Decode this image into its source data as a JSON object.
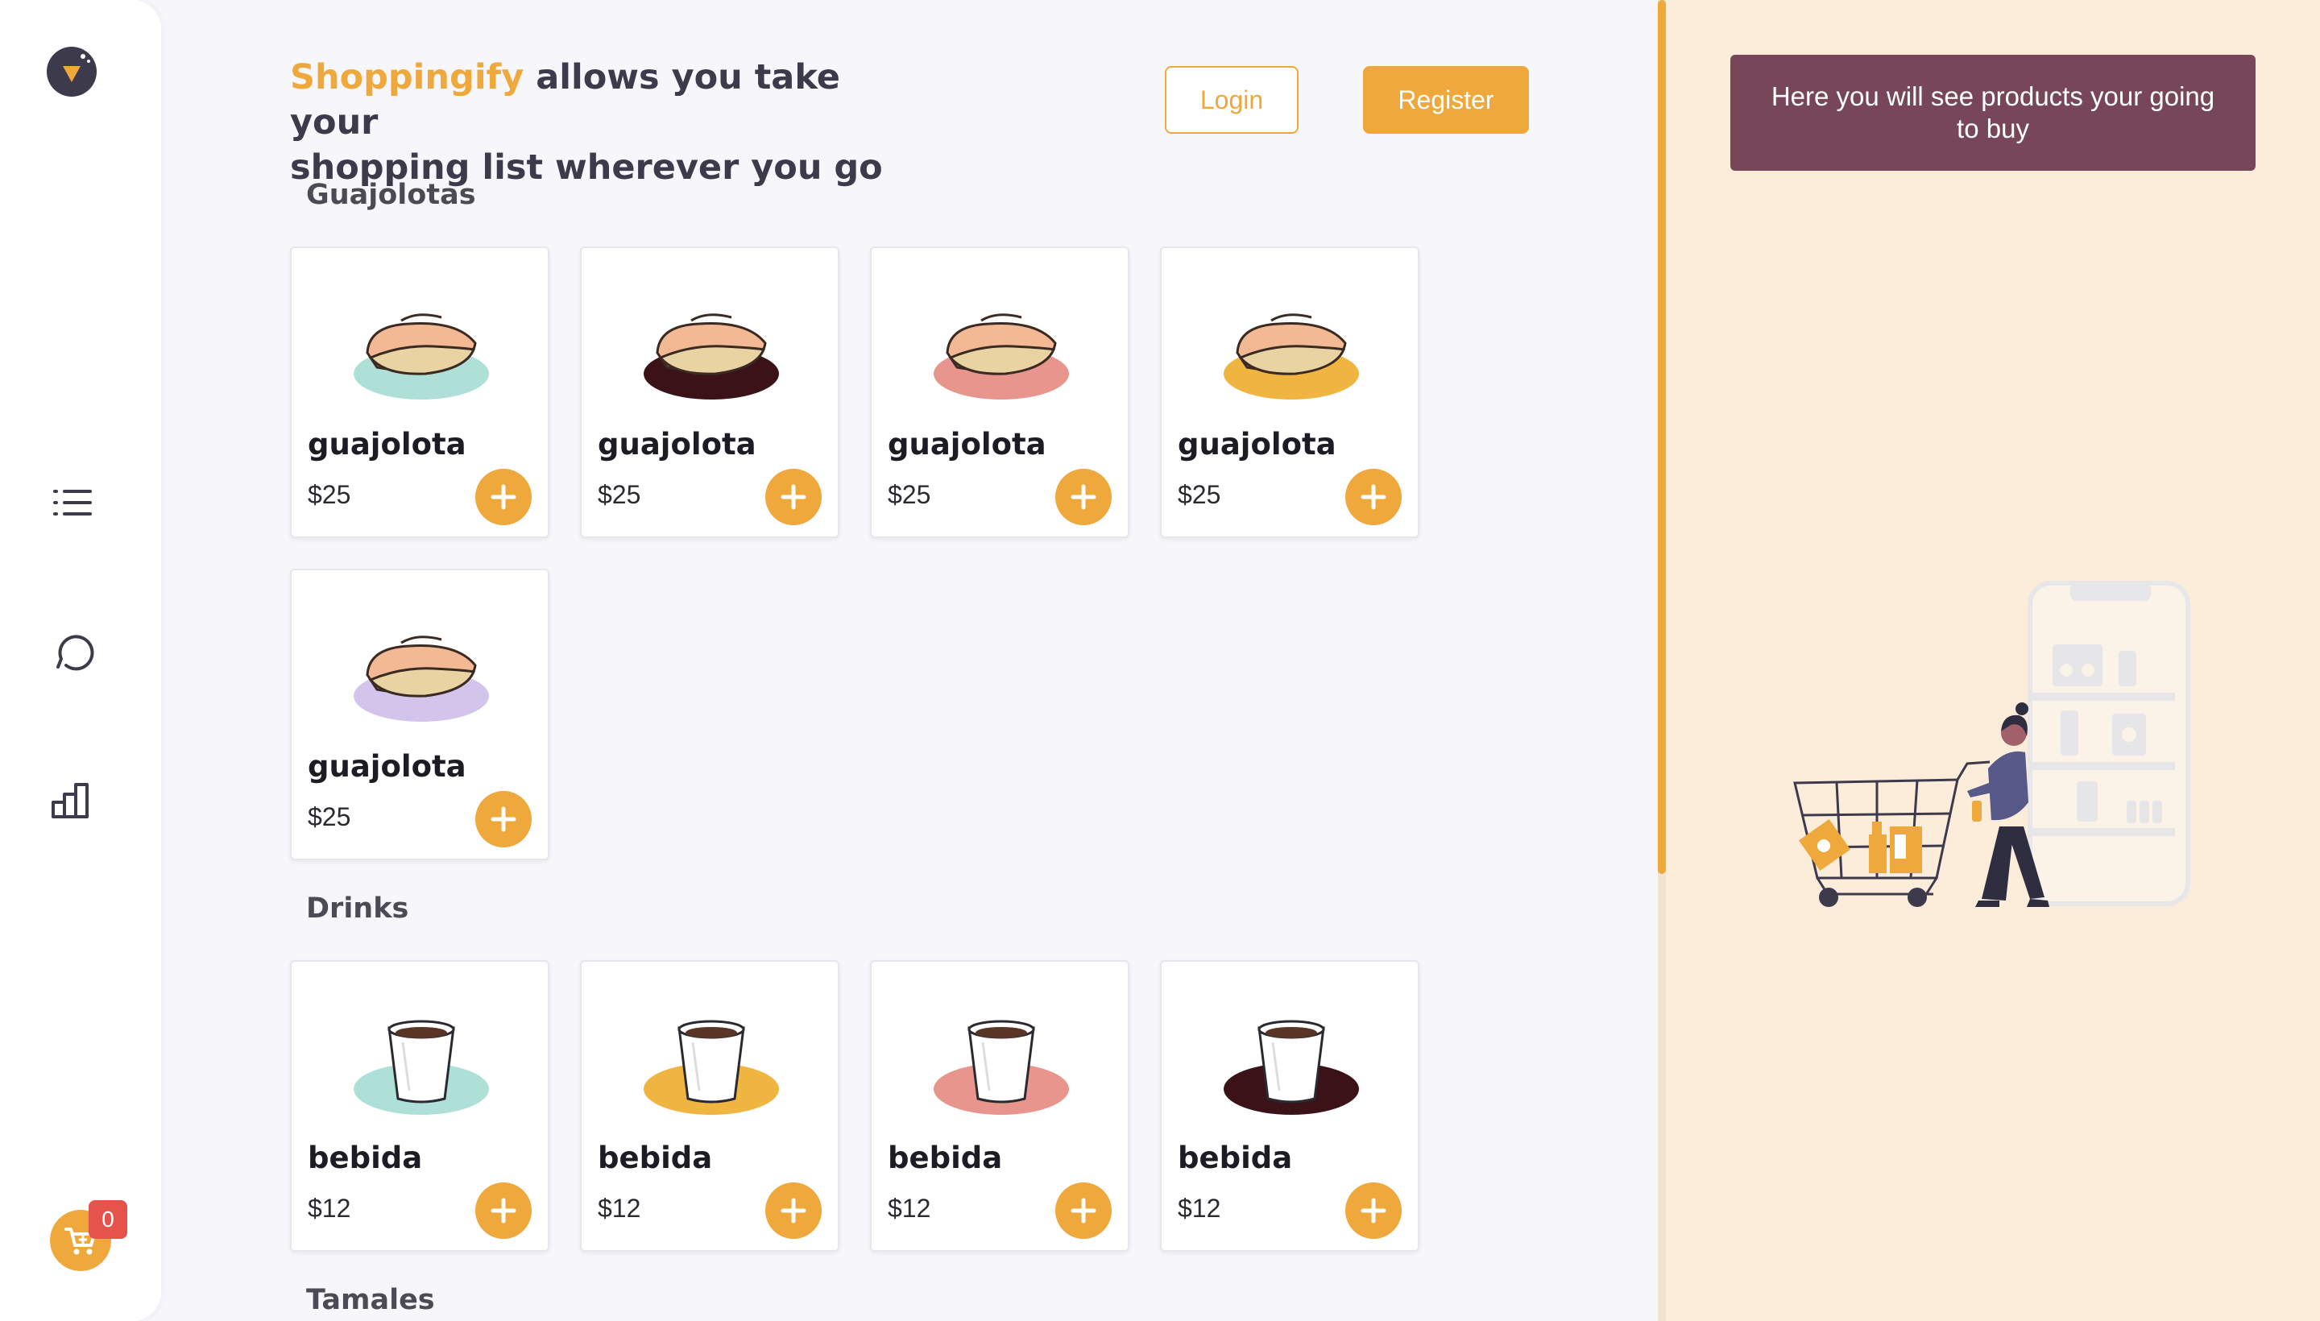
{
  "sidebar": {
    "logo": "shoppingify-logo",
    "nav": [
      {
        "icon": "list-icon",
        "name": "items"
      },
      {
        "icon": "history-icon",
        "name": "history"
      },
      {
        "icon": "stats-icon",
        "name": "statistics"
      }
    ],
    "cart": {
      "icon": "cart-icon",
      "count": "0"
    }
  },
  "header": {
    "brand": "Shoppingify",
    "headline_line1": " allows you take your",
    "headline_line2": "shopping list wherever you go",
    "login_label": "Login",
    "register_label": "Register"
  },
  "categories": [
    {
      "title": "Guajolotas",
      "items": [
        {
          "name": "guajolota",
          "price": "$25",
          "color": "#aee0d8"
        },
        {
          "name": "guajolota",
          "price": "$25",
          "color": "#3a1217"
        },
        {
          "name": "guajolota",
          "price": "$25",
          "color": "#e8958d"
        },
        {
          "name": "guajolota",
          "price": "$25",
          "color": "#f0b441"
        },
        {
          "name": "guajolota",
          "price": "$25",
          "color": "#d3c4ec"
        }
      ]
    },
    {
      "title": "Drinks",
      "items": [
        {
          "name": "bebida",
          "price": "$12",
          "color": "#aee0d8"
        },
        {
          "name": "bebida",
          "price": "$12",
          "color": "#f0b441"
        },
        {
          "name": "bebida",
          "price": "$12",
          "color": "#e8958d"
        },
        {
          "name": "bebida",
          "price": "$12",
          "color": "#3a1217"
        }
      ]
    },
    {
      "title": "Tamales",
      "items": []
    }
  ],
  "right_panel": {
    "notice": "Here you will see products your going to buy"
  },
  "colors": {
    "accent": "#eea83b",
    "dark": "#3d3a4b",
    "notice_bg": "#774759",
    "panel_bg": "#fcecda",
    "badge": "#e5534b"
  }
}
